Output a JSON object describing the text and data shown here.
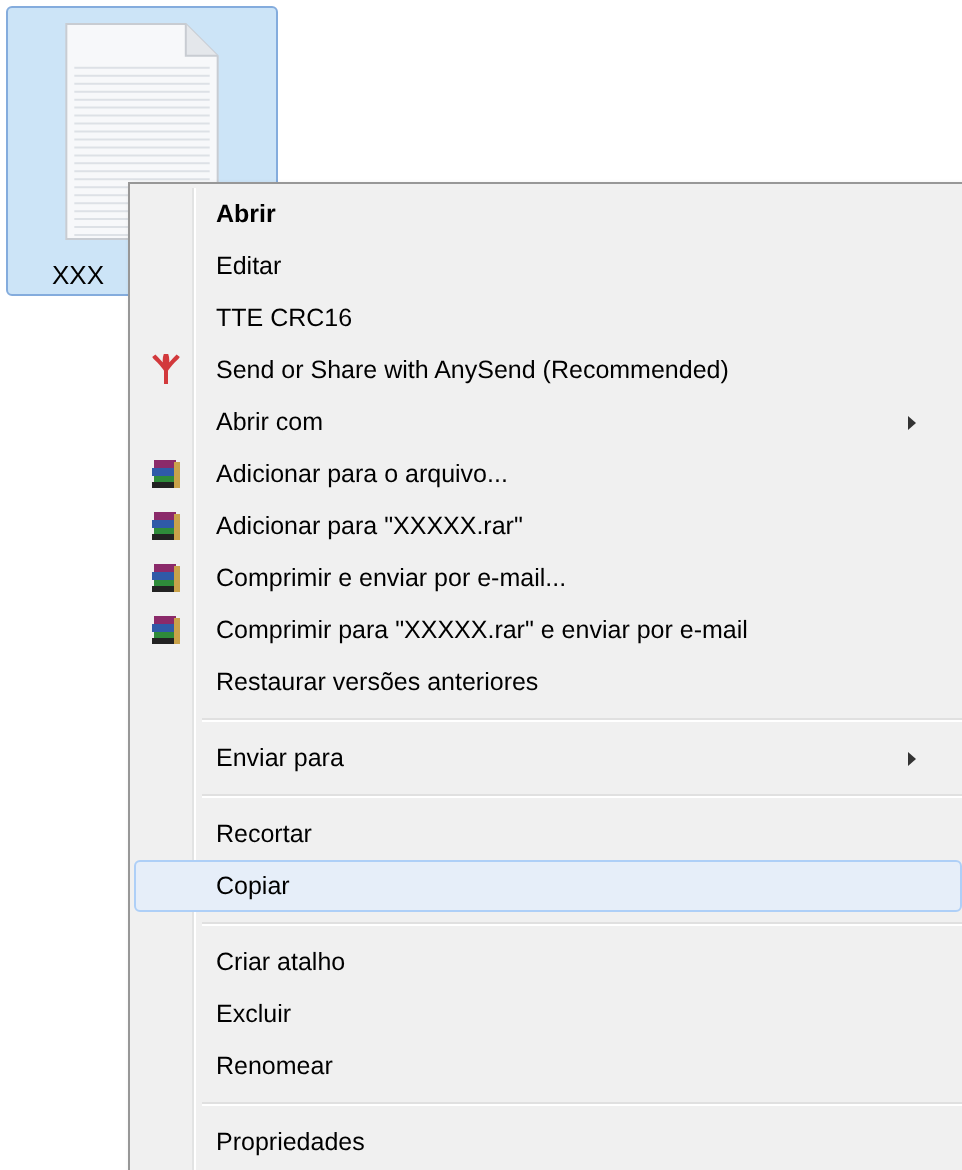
{
  "file": {
    "label": "XXX",
    "selected": true
  },
  "menu": {
    "items": [
      {
        "kind": "item",
        "label": "Abrir",
        "default": true,
        "selected": false
      },
      {
        "kind": "item",
        "label": "Editar",
        "selected": false
      },
      {
        "kind": "item",
        "label": "TTE CRC16",
        "selected": false
      },
      {
        "kind": "flower-item",
        "label": "Send or Share with AnySend (Recommended)",
        "selected": false
      },
      {
        "kind": "item",
        "label": "Abrir com",
        "submenu": true,
        "selected": false
      },
      {
        "kind": "books-item",
        "label": "Adicionar para o arquivo...",
        "selected": false
      },
      {
        "kind": "books-item",
        "label": "Adicionar para \"XXXXX.rar\"",
        "selected": false
      },
      {
        "kind": "books-item",
        "label": "Comprimir e enviar por e-mail...",
        "selected": false
      },
      {
        "kind": "books-item",
        "label": "Comprimir para \"XXXXX.rar\" e enviar por e-mail",
        "selected": false
      },
      {
        "kind": "item",
        "label": "Restaurar versões anteriores",
        "selected": false
      },
      {
        "kind": "separator"
      },
      {
        "kind": "item",
        "label": "Enviar para",
        "submenu": true,
        "selected": false
      },
      {
        "kind": "separator"
      },
      {
        "kind": "item",
        "label": "Recortar",
        "selected": false
      },
      {
        "kind": "item",
        "label": "Copiar",
        "selected": true
      },
      {
        "kind": "separator"
      },
      {
        "kind": "item",
        "label": "Criar atalho",
        "selected": false
      },
      {
        "kind": "item",
        "label": "Excluir",
        "selected": false
      },
      {
        "kind": "item",
        "label": "Renomear",
        "selected": false
      },
      {
        "kind": "separator"
      },
      {
        "kind": "item",
        "label": "Propriedades",
        "selected": false
      }
    ]
  }
}
